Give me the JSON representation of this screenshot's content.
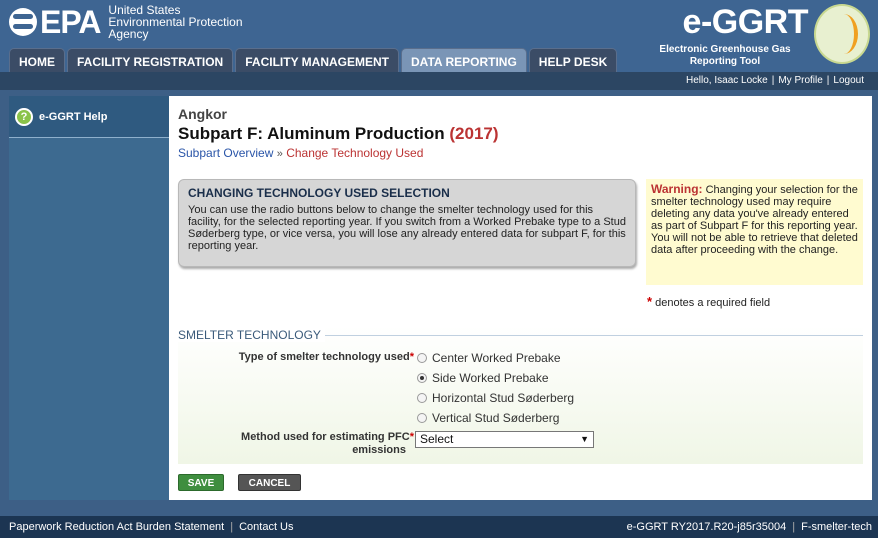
{
  "header": {
    "agency_line1": "United States",
    "agency_line2": "Environmental Protection",
    "agency_line3": "Agency",
    "epa_mark": "EPA",
    "app_title": "e-GGRT",
    "app_subtitle": "Electronic Greenhouse Gas Reporting Tool"
  },
  "nav": {
    "tabs": [
      {
        "label": "HOME"
      },
      {
        "label": "FACILITY REGISTRATION"
      },
      {
        "label": "FACILITY MANAGEMENT"
      },
      {
        "label": "DATA REPORTING"
      },
      {
        "label": "HELP DESK"
      }
    ]
  },
  "userbar": {
    "greeting": "Hello, Isaac Locke",
    "profile": "My Profile",
    "logout": "Logout"
  },
  "sidebar": {
    "help_label": "e-GGRT Help"
  },
  "main": {
    "facility": "Angkor",
    "title": "Subpart F: Aluminum Production",
    "year": "(2017)",
    "breadcrumb_link": "Subpart Overview",
    "breadcrumb_sep": "»",
    "breadcrumb_current": "Change Technology Used",
    "info_title": "CHANGING TECHNOLOGY USED SELECTION",
    "info_text": "You can use the radio buttons below to change the smelter technology used for this facility, for the selected reporting year. If you switch from a Worked Prebake type to a Stud Søderberg type, or vice versa, you will lose any already entered data for subpart F, for this reporting year.",
    "warning_label": "Warning:",
    "warning_text": "Changing your selection for the smelter technology used may require deleting any data you've already entered as part of Subpart F for this reporting year. You will not be able to retrieve that deleted data after proceeding with the change.",
    "required_note": "denotes a required field",
    "section_title": "SMELTER TECHNOLOGY",
    "tech_label": "Type of smelter technology used",
    "options": [
      {
        "label": "Center Worked Prebake",
        "checked": false
      },
      {
        "label": "Side Worked Prebake",
        "checked": true
      },
      {
        "label": "Horizontal Stud Søderberg",
        "checked": false
      },
      {
        "label": "Vertical Stud Søderberg",
        "checked": false
      }
    ],
    "method_label_line1": "Method used for estimating PFC",
    "method_label_line2": "emissions",
    "method_value": "Select",
    "save_label": "SAVE",
    "cancel_label": "CANCEL"
  },
  "footer": {
    "paperwork": "Paperwork Reduction Act Burden Statement",
    "contact": "Contact Us",
    "version": "e-GGRT RY2017.R20-j85r35004",
    "page_id": "F-smelter-tech"
  }
}
